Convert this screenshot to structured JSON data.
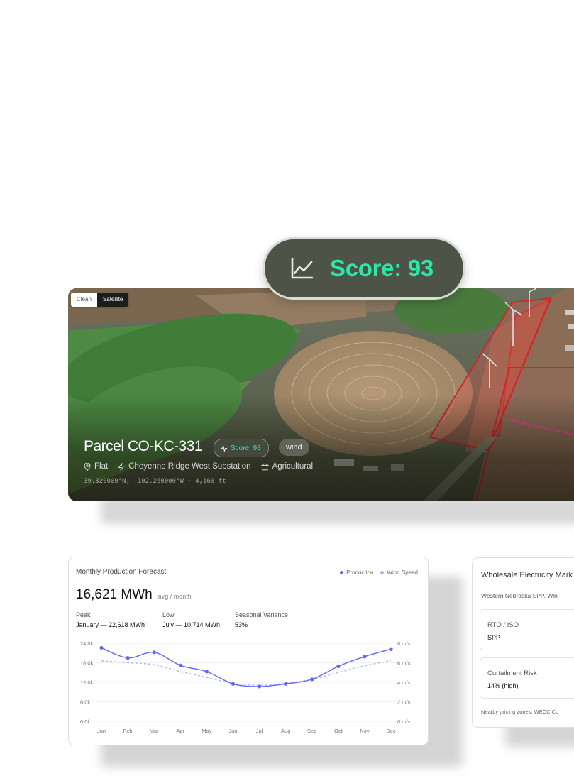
{
  "map_toggle": {
    "options": [
      "Clean",
      "Satellite"
    ],
    "selected": "Satellite"
  },
  "score_badge": {
    "label": "Score: 93",
    "icon": "trend-line-icon"
  },
  "parcel": {
    "title": "Parcel CO-KC-331",
    "score_label": "Score: 93",
    "tag": "wind",
    "terrain": "Flat",
    "substation": "Cheyenne Ridge West Substation",
    "zoning": "Agricultural",
    "coords": "39.320000°N, -102.260000°W · 4,160 ft"
  },
  "forecast": {
    "title": "Monthly Production Forecast",
    "legend": [
      "Production",
      "Wind Speed"
    ],
    "avg_value": "16,621 MWh",
    "avg_unit": "avg / month",
    "stats": [
      {
        "label": "Peak",
        "value": "January — 22,618 MWh"
      },
      {
        "label": "Low",
        "value": "July — 10,714 MWh"
      },
      {
        "label": "Seasonal Variance",
        "value": "53%"
      }
    ],
    "colors": {
      "production": "#6366f1",
      "wind": "#a5b4fc"
    }
  },
  "chart_data": {
    "type": "line",
    "categories": [
      "Jan",
      "Feb",
      "Mar",
      "Apr",
      "May",
      "Jun",
      "Jul",
      "Aug",
      "Sep",
      "Oct",
      "Nov",
      "Dec"
    ],
    "series": [
      {
        "name": "Production",
        "axis": "left",
        "values": [
          22.6,
          19.5,
          21.2,
          17.2,
          15.3,
          11.5,
          10.7,
          11.5,
          12.9,
          16.9,
          19.9,
          22.2
        ]
      },
      {
        "name": "Wind Speed",
        "axis": "right",
        "values": [
          6.2,
          6.0,
          5.8,
          5.1,
          4.5,
          3.9,
          3.7,
          3.9,
          4.3,
          5.0,
          5.7,
          6.2
        ]
      }
    ],
    "y_left": {
      "ticks": [
        "24.0k",
        "18.0k",
        "12.0k",
        "6.0k",
        "0.0k"
      ],
      "range": [
        0,
        24
      ]
    },
    "y_right": {
      "ticks": [
        "8 m/s",
        "6 m/s",
        "4 m/s",
        "2 m/s",
        "0 m/s"
      ],
      "range": [
        0,
        8
      ]
    },
    "grid": true,
    "legend_position": "top-right"
  },
  "market": {
    "title": "Wholesale Electricity Mark",
    "description": "Western Nebraska SPP. Win",
    "items": [
      {
        "label": "RTO / ISO",
        "value": "SPP"
      },
      {
        "label": "Curtailment Risk",
        "value": "14% (high)"
      }
    ],
    "footer": "Nearby pricing zones: WECC Co"
  }
}
